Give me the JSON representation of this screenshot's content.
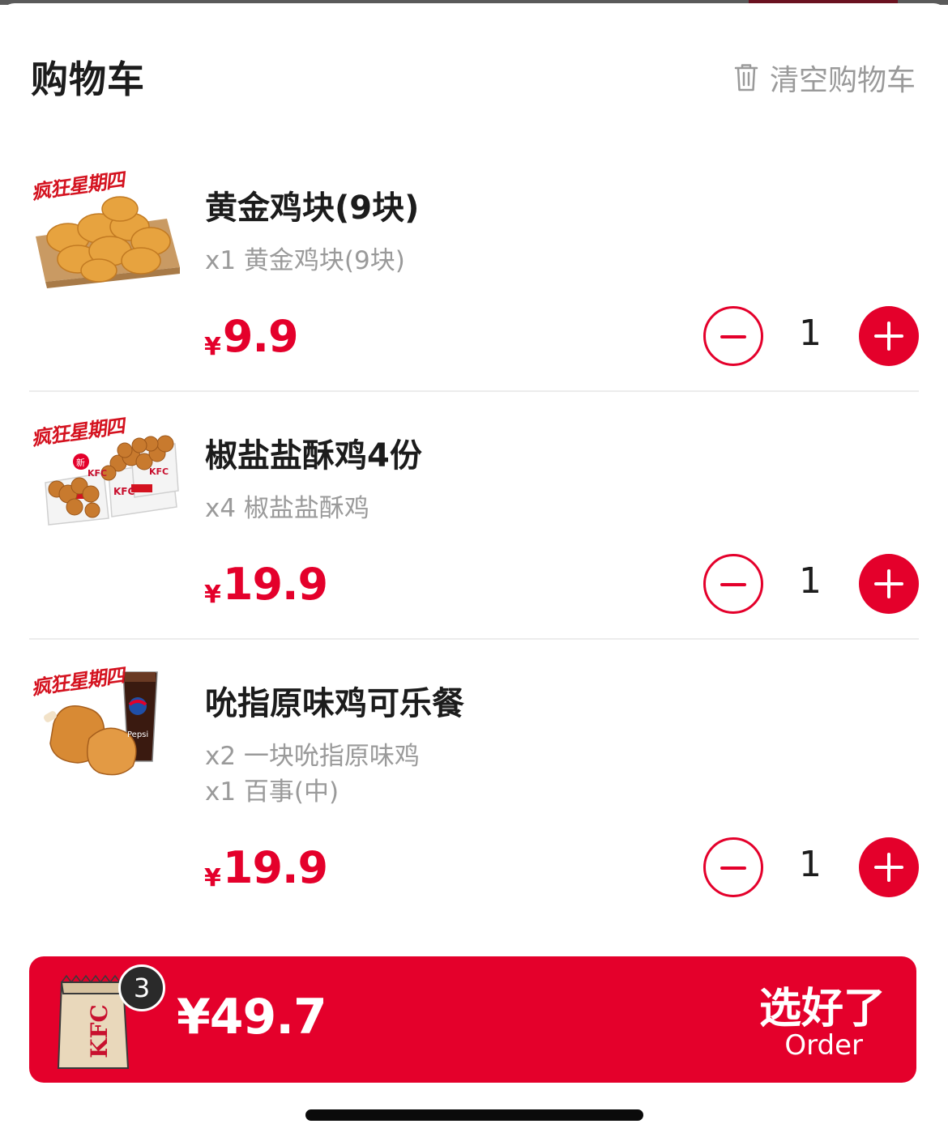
{
  "header": {
    "title": "购物车",
    "clear_label": "清空购物车"
  },
  "promo_tag": "疯狂星期四",
  "items": [
    {
      "name": "黄金鸡块(9块)",
      "desc": [
        "x1 黄金鸡块(9块)"
      ],
      "currency": "¥",
      "price": "9.9",
      "quantity": "1"
    },
    {
      "name": "椒盐盐酥鸡4份",
      "desc": [
        "x4 椒盐盐酥鸡"
      ],
      "currency": "¥",
      "price": "19.9",
      "quantity": "1"
    },
    {
      "name": "吮指原味鸡可乐餐",
      "desc": [
        "x2 一块吮指原味鸡",
        "x1 百事(中)"
      ],
      "currency": "¥",
      "price": "19.9",
      "quantity": "1"
    }
  ],
  "image_labels": {
    "kfc": "KFC",
    "new": "新",
    "pepsi": "Pepsi"
  },
  "checkout": {
    "count": "3",
    "total": "¥49.7",
    "order_label_zh": "选好了",
    "order_label_en": "Order"
  },
  "colors": {
    "accent": "#e4002b",
    "text_primary": "#1c1c1c",
    "text_secondary": "#9a9a9a"
  }
}
